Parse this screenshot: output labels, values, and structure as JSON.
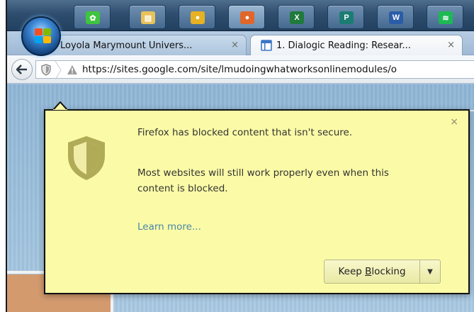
{
  "taskbar": {
    "pinned": [
      {
        "name": "media-player-icon",
        "glyph": "✿",
        "color": "#3ec43e"
      },
      {
        "name": "file-explorer-icon",
        "glyph": "▤",
        "color": "#e8c25a"
      },
      {
        "name": "chrome-icon",
        "glyph": "●",
        "color": "#e6b122"
      },
      {
        "name": "firefox-icon",
        "glyph": "●",
        "color": "#e0662a"
      },
      {
        "name": "excel-icon",
        "glyph": "X",
        "color": "#1f7a3c"
      },
      {
        "name": "publisher-icon",
        "glyph": "P",
        "color": "#1b7c73"
      },
      {
        "name": "word-icon",
        "glyph": "W",
        "color": "#2b5ca8"
      },
      {
        "name": "spotify-icon",
        "glyph": "≋",
        "color": "#1db954"
      }
    ]
  },
  "tabs": [
    {
      "label": "Loyola Marymount Univers...",
      "close": "×",
      "active": false
    },
    {
      "label": "1. Dialogic Reading: Resear...",
      "close": "×",
      "active": true
    }
  ],
  "navbar": {
    "url": "https://sites.google.com/site/lmudoingwhatworksonlinemodules/o"
  },
  "panel": {
    "close": "×",
    "line1": "Firefox has blocked content that isn't secure.",
    "line2": "Most websites will still work properly even when this content is blocked.",
    "learn_more": "Learn more...",
    "button_prefix": "Keep ",
    "button_accesskey": "B",
    "button_suffix": "locking",
    "button_menu": "▼"
  },
  "colors": {
    "panel_background": "#fbfba7",
    "link": "#4a85a8",
    "shield": "#b0ab57"
  }
}
